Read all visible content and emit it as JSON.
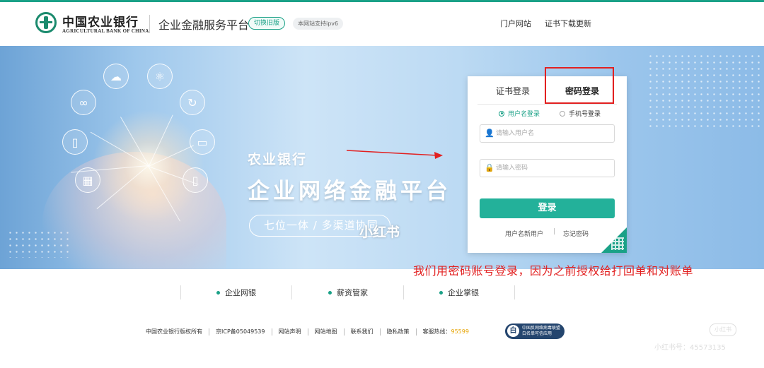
{
  "header": {
    "bank_name_cn": "中国农业银行",
    "bank_name_en": "AGRICULTURAL BANK OF CHINA",
    "platform_title": "企业金融服务平台",
    "switch_old_label": "切换旧版",
    "ipv6_label": "本网站支持ipv6",
    "nav": {
      "portal": "门户网站",
      "cert_download": "证书下载更新"
    }
  },
  "banner": {
    "slogan_small": "农业银行",
    "slogan_big": "企业网络金融平台",
    "pill_text": "七位一体 / 多渠道协同",
    "watermark": "小红书"
  },
  "login": {
    "tabs": {
      "cert": "证书登录",
      "password": "密码登录"
    },
    "active_tab": "密码登录",
    "radio_user": "用户名登录",
    "radio_phone": "手机号登录",
    "username_placeholder": "请输入用户名",
    "password_placeholder": "请输入密码",
    "submit": "登录",
    "new_user": "用户名新用户",
    "link_sep": "|",
    "forgot": "忘记密码"
  },
  "annotation": "我们用密码账号登录，因为之前授权给打回单和对账单",
  "products": [
    "企业网银",
    "薪资管家",
    "企业掌银"
  ],
  "footer": {
    "copyright": "中国农业银行版权所有",
    "icp": "京ICP备05049539",
    "statement": "网站声明",
    "sitemap": "网站地图",
    "contact": "联系我们",
    "privacy": "隐私政策",
    "hotline_label": "客服热线：",
    "hotline_number": "95599",
    "badge_line1": "中国反网络病毒联盟",
    "badge_line2": "白名单可信应用",
    "badge_icon": "白"
  },
  "watermark": {
    "logo": "小红书",
    "id": "小红书号：45573135"
  },
  "colors": {
    "brand_green": "#1aa187",
    "button_green": "#23b19a",
    "annotation_red": "#e22020",
    "hotline": "#e6a300"
  }
}
